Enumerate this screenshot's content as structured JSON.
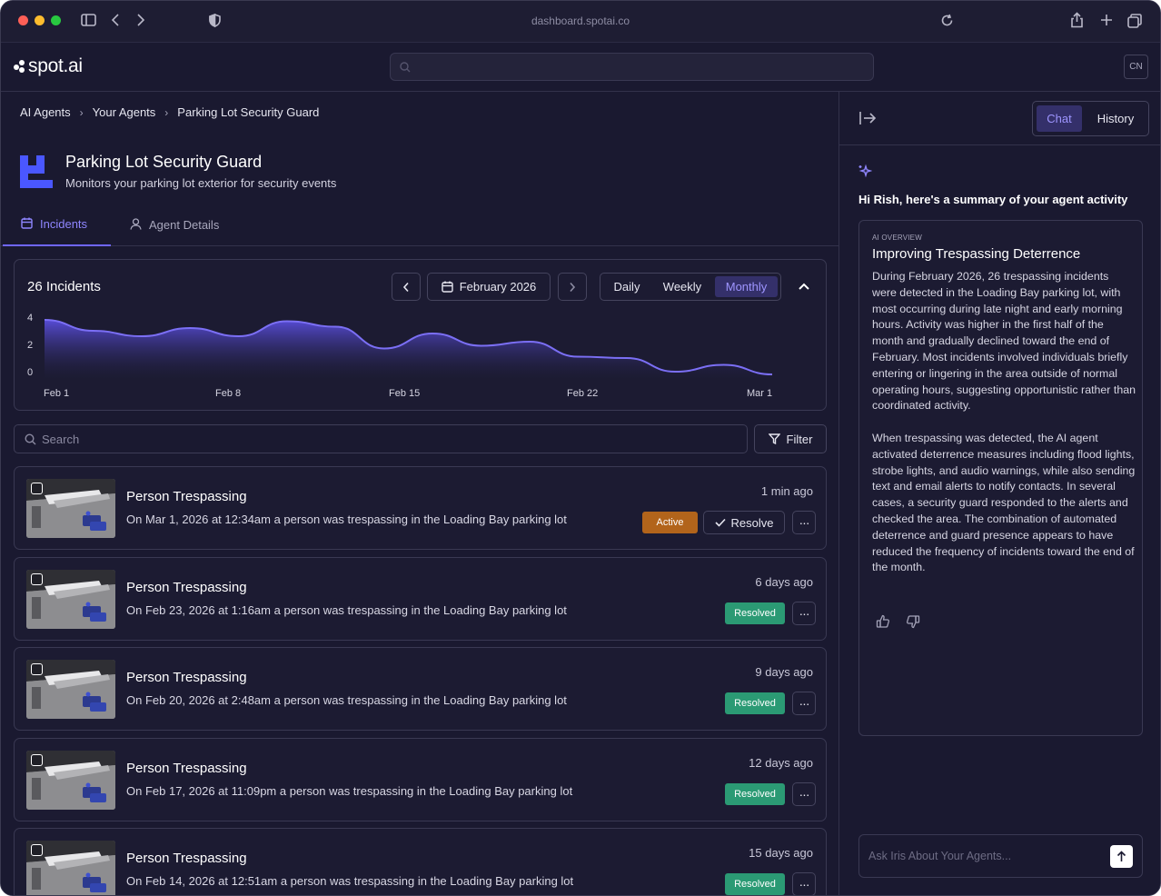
{
  "browser": {
    "url": "dashboard.spotai.co"
  },
  "header": {
    "logo": "spot.ai",
    "search_placeholder": "",
    "user_initials": "CN"
  },
  "breadcrumb": [
    "AI Agents",
    "Your Agents",
    "Parking Lot Security Guard"
  ],
  "agent": {
    "name": "Parking Lot Security Guard",
    "description": "Monitors your parking lot exterior for security events"
  },
  "tabs": [
    {
      "label": "Incidents",
      "icon": "calendar-icon"
    },
    {
      "label": "Agent Details",
      "icon": "user-icon"
    }
  ],
  "incidents_card": {
    "count_label": "26 Incidents",
    "period": "February 2026",
    "ranges": [
      "Daily",
      "Weekly",
      "Monthly"
    ],
    "selected_range": "Monthly"
  },
  "chart_data": {
    "type": "area",
    "x_ticks": [
      "Feb 1",
      "Feb 8",
      "Feb 15",
      "Feb 22",
      "Mar 1"
    ],
    "y_ticks": [
      "4",
      "2",
      "0"
    ],
    "ylim": [
      0,
      4
    ],
    "series": [
      {
        "values": [
          3.8,
          3.0,
          2.6,
          3.2,
          2.6,
          3.7,
          3.3,
          1.7,
          2.8,
          1.9,
          2.2,
          1.1,
          1.0,
          0.0,
          0.5,
          -0.2
        ]
      }
    ],
    "color": "#7b6ff5"
  },
  "search": {
    "placeholder": "Search"
  },
  "filter_label": "Filter",
  "incidents": [
    {
      "title": "Person Trespassing",
      "description": "On Mar 1, 2026 at 12:34am a person was trespassing in the Loading Bay parking lot",
      "time": "1 min ago",
      "status": "Active",
      "action": "Resolve"
    },
    {
      "title": "Person Trespassing",
      "description": "On Feb 23, 2026 at 1:16am a person was trespassing in the Loading Bay parking lot",
      "time": "6 days ago",
      "status": "Resolved"
    },
    {
      "title": "Person Trespassing",
      "description": "On Feb 20, 2026 at 2:48am a person was trespassing in the Loading Bay parking lot",
      "time": "9 days ago",
      "status": "Resolved"
    },
    {
      "title": "Person Trespassing",
      "description": "On Feb 17, 2026 at 11:09pm a person was trespassing in the Loading Bay parking lot",
      "time": "12 days ago",
      "status": "Resolved"
    },
    {
      "title": "Person Trespassing",
      "description": "On Feb 14, 2026 at 12:51am a person was trespassing in the Loading Bay parking lot",
      "time": "15 days ago",
      "status": "Resolved"
    }
  ],
  "more_label": "···",
  "side": {
    "tabs": [
      "Chat",
      "History"
    ],
    "greeting": "Hi Rish, here's a summary of your agent activity",
    "overview_kicker": "AI OVERVIEW",
    "overview_title": "Improving Trespassing Deterrence",
    "overview_p1": "During February 2026, 26 trespassing incidents were detected in the Loading Bay parking lot, with most occurring during late night and early morning hours. Activity was higher in the first half of the month and gradually declined toward the end of February. Most incidents involved individuals briefly entering or lingering in the area outside of normal operating hours, suggesting opportunistic rather than coordinated activity.",
    "overview_p2": "When trespassing was detected, the AI agent activated deterrence measures including flood lights, strobe lights, and audio warnings, while also sending text and email alerts to notify contacts. In several cases, a security guard responded to the alerts and checked the area. The combination of automated deterrence and guard presence appears to have reduced the frequency of incidents toward the end of the month.",
    "ask_placeholder": "Ask Iris About Your Agents..."
  }
}
